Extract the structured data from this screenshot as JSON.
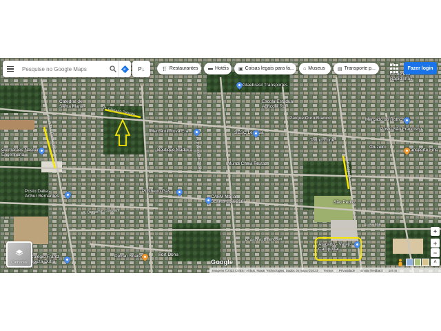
{
  "search": {
    "placeholder": "Pesquise no Google Maps"
  },
  "lang_chip": {
    "label": "P↓"
  },
  "chips": [
    {
      "label": "Restaurantes",
      "icon": "fork-knife-icon"
    },
    {
      "label": "Hotéis",
      "icon": "bed-icon"
    },
    {
      "label": "Coisas legais para fa...",
      "icon": "camera-icon"
    },
    {
      "label": "Museus",
      "icon": "museum-icon"
    },
    {
      "label": "Transporte p...",
      "icon": "bus-icon"
    }
  ],
  "chip_more": ">",
  "login_label": "Fazer login",
  "places": {
    "glaebrasil": "Glaebrasil Transportes",
    "mercantil": "Mercantil Nova Era",
    "catedral": "Catedral de\nSanta Maria",
    "clube": "Clube dos\nRapidinhos",
    "gulmaraes": "Gulmarães Nasser\nEngenharia...",
    "sesc": "SESC Ler Rua",
    "posto": "Posto Dalla -\nArthur Bernardes",
    "plnheiro": "PLNheiro Gás",
    "colegio": "Colégio Frantz\nSouza Dutra",
    "detran": "Detran Soares",
    "cafm": "CAFM Maria\nSoares Loja 218",
    "sao_pedro": "São Pedro",
    "torino": "Torino Corte",
    "cruzeiro": "Cruzeiro",
    "mercado_ruth": "Mercado do Rothchille",
    "escola": "Escola Estadual\nAgrícola Ruf",
    "posto_sao": "Posto São Francisco",
    "parque": "Parque Ouro Branco",
    "boutique": "Boutique Madeira",
    "fort_doha": "Fort Doha",
    "vereza": "Mundi Cheia Festas",
    "atacado": "Atacado - Varejo\nCampodal",
    "transporte": "Transporte Fins"
  },
  "roads": {
    "r1": "R. Floriano Peixoto",
    "r2": "R. Benjamin Constant",
    "r3": "Av. Arthur Bernardes",
    "r4": "R. Plácido de Castro",
    "r5": "R. Antônio Bittencourt",
    "r6": "R. Japurá",
    "r7": "R. Paraná"
  },
  "layers_label": "Camadas",
  "brand": "Google",
  "footer": {
    "imagery": "Imagens ©2023 CNES / Airbus, Maxar Technologies, Dados do mapa ©2023",
    "terms": "Termos",
    "privacy": "Privacidade",
    "feedback": "Enviar feedback",
    "scale": "100 m"
  },
  "colors": {
    "annotation": "#f7e600",
    "accent": "#1a73e8",
    "pin_blue": "#4a8ef0",
    "pin_orange": "#f29a2e"
  }
}
